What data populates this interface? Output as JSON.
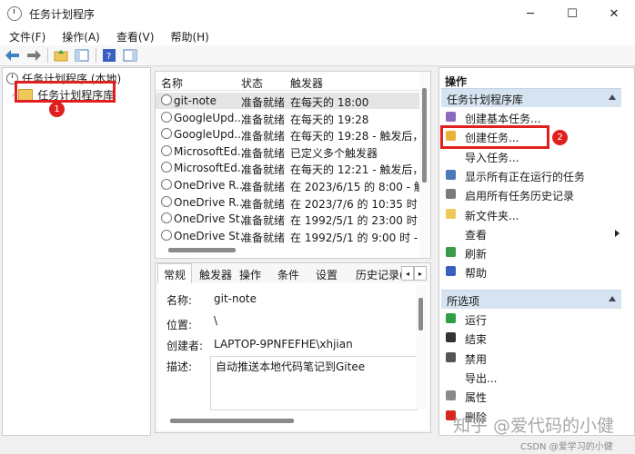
{
  "window": {
    "title": "任务计划程序",
    "controls": [
      "─",
      "☐",
      "✕"
    ]
  },
  "menubar": {
    "items": [
      "文件(F)",
      "操作(A)",
      "查看(V)",
      "帮助(H)"
    ]
  },
  "toolbar": {
    "icons": [
      "arrow-left-icon",
      "arrow-right-icon",
      "folder-up-icon",
      "panel-icon",
      "help-icon",
      "pane-toggle-icon"
    ]
  },
  "tree": {
    "root": "任务计划程序 (本地)",
    "child": "任务计划程序库",
    "badge": "1"
  },
  "task_list": {
    "columns": [
      "名称",
      "状态",
      "触发器"
    ],
    "rows": [
      {
        "name": "git-note",
        "status": "准备就绪",
        "trigger": "在每天的 18:00"
      },
      {
        "name": "GoogleUpd...",
        "status": "准备就绪",
        "trigger": "在每天的 19:28"
      },
      {
        "name": "GoogleUpd...",
        "status": "准备就绪",
        "trigger": "在每天的 19:28 - 触发后，在"
      },
      {
        "name": "MicrosoftEd...",
        "status": "准备就绪",
        "trigger": "已定义多个触发器"
      },
      {
        "name": "MicrosoftEd...",
        "status": "准备就绪",
        "trigger": "在每天的 12:21 - 触发后，在"
      },
      {
        "name": "OneDrive R...",
        "status": "准备就绪",
        "trigger": "在 2023/6/15 的 8:00 - 触发"
      },
      {
        "name": "OneDrive R...",
        "status": "准备就绪",
        "trigger": "在 2023/7/6 的 10:35 时 - 触"
      },
      {
        "name": "OneDrive St...",
        "status": "准备就绪",
        "trigger": "在 1992/5/1 的 23:00 时 - 触"
      },
      {
        "name": "OneDrive St...",
        "status": "准备就绪",
        "trigger": "在 1992/5/1 的 9:00 时 - 触发"
      }
    ]
  },
  "detail": {
    "tabs": [
      "常规",
      "触发器",
      "操作",
      "条件",
      "设置",
      "历史记录("
    ],
    "tab_arrows": [
      "◂",
      "▸"
    ],
    "fields": [
      {
        "label": "名称:",
        "value": "git-note"
      },
      {
        "label": "位置:",
        "value": "\\"
      },
      {
        "label": "创建者:",
        "value": "LAPTOP-9PNFEFHE\\xhjian"
      },
      {
        "label": "描述:",
        "value": "自动推送本地代码笔记到Gitee"
      }
    ]
  },
  "actions": {
    "title": "操作",
    "section1": {
      "header": "任务计划程序库",
      "items": [
        {
          "label": "创建基本任务...",
          "icon": "wizard-icon",
          "color": "#8c6bbf"
        },
        {
          "label": "创建任务...",
          "icon": "new-task-icon",
          "color": "#e8b23a"
        },
        {
          "label": "导入任务...",
          "icon": "blank-icon",
          "color": "#ffffff"
        },
        {
          "label": "显示所有正在运行的任务",
          "icon": "running-tasks-icon",
          "color": "#4a78b8"
        },
        {
          "label": "启用所有任务历史记录",
          "icon": "history-icon",
          "color": "#7a7a7a"
        },
        {
          "label": "新文件夹...",
          "icon": "folder-icon",
          "color": "#f0c85a"
        },
        {
          "label": "查看",
          "icon": "blank-icon",
          "color": "#ffffff",
          "submenu": true
        },
        {
          "label": "刷新",
          "icon": "refresh-icon",
          "color": "#3a9a4a"
        },
        {
          "label": "帮助",
          "icon": "help-icon",
          "color": "#3a5fbf"
        }
      ],
      "badge": "2"
    },
    "section2": {
      "header": "所选项",
      "items": [
        {
          "label": "运行",
          "icon": "run-icon",
          "color": "#2f9e44"
        },
        {
          "label": "结束",
          "icon": "stop-icon",
          "color": "#333333"
        },
        {
          "label": "禁用",
          "icon": "disable-icon",
          "color": "#555555"
        },
        {
          "label": "导出...",
          "icon": "blank-icon",
          "color": "#ffffff"
        },
        {
          "label": "属性",
          "icon": "properties-icon",
          "color": "#8a8a8a"
        },
        {
          "label": "删除",
          "icon": "delete-icon",
          "color": "#d9261c"
        }
      ]
    }
  },
  "watermark": {
    "main": "知乎 @爱代码的小健",
    "csdn": "CSDN @爱学习的小健"
  },
  "colors": {
    "highlight_box": "#e0201e",
    "section_header": "#d6e3f0",
    "selected_row": "#e5e5e5"
  }
}
